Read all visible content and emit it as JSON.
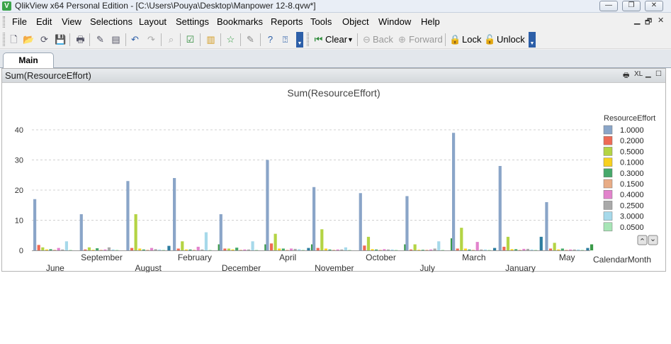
{
  "window": {
    "title": "QlikView x64 Personal Edition - [C:\\Users\\Pouya\\Desktop\\Manpower 12-8.qvw*]",
    "app_icon_letter": "V",
    "minimize": "—",
    "restore": "❐",
    "close": "✕"
  },
  "menu": {
    "items": [
      "File",
      "Edit",
      "View",
      "Selections",
      "Layout",
      "Settings",
      "Bookmarks",
      "Reports",
      "Tools",
      "Object",
      "Window",
      "Help"
    ],
    "mdi_minimize": "▁",
    "mdi_restore": "🗗",
    "mdi_close": "✕"
  },
  "toolbar": {
    "icons": [
      "new-icon",
      "open-icon",
      "reload-icon",
      "save-icon",
      "print-icon",
      "edit-script-icon",
      "reload-script-icon",
      "undo-icon",
      "redo-icon",
      "search-icon",
      "select-fields-icon",
      "new-chart-icon",
      "bookmark-star-icon",
      "edit-icon",
      "help-icon",
      "context-help-icon"
    ],
    "clear_label": "Clear",
    "back_label": "Back",
    "forward_label": "Forward",
    "lock_label": "Lock",
    "unlock_label": "Unlock"
  },
  "tabs": [
    {
      "label": "Main"
    }
  ],
  "chart_caption": {
    "title": "Sum(ResourceEffort)",
    "print_icon": "🖶",
    "xl_label": "XL",
    "minimize": "▁",
    "maximize": "☐"
  },
  "colors": {
    "1.0000": "#8aa5c8",
    "0.2000": "#ee6a55",
    "0.5000": "#b4d444",
    "0.1000": "#f7d11f",
    "0.3000": "#46a86a",
    "0.1500": "#e8ac86",
    "0.4000": "#e283cc",
    "0.2500": "#a9a9a9",
    "3.0000": "#a6d9ea",
    "0.0500": "#a7e5b6",
    "misc_dark_green": "#3a9a48",
    "misc_teal": "#2e7da0",
    "misc_dark": "#555555"
  },
  "chart_data": {
    "type": "bar",
    "title": "Sum(ResourceEffort)",
    "xlabel": "CalendarMonth",
    "legend_title": "ResourceEffort",
    "legend_position": "right",
    "ylim": [
      0,
      40
    ],
    "yticks": [
      0,
      10,
      20,
      30,
      40
    ],
    "grid": true,
    "categories": [
      "June",
      "September",
      "August",
      "February",
      "December",
      "April",
      "November",
      "October",
      "July",
      "March",
      "January",
      "May"
    ],
    "series": [
      {
        "name": "1.0000",
        "values": [
          17,
          12,
          23,
          24,
          12,
          30,
          21,
          19,
          18,
          39,
          28,
          16
        ]
      },
      {
        "name": "0.2000",
        "values": [
          1.8,
          0.3,
          0.8,
          0.6,
          0.6,
          2.3,
          0.8,
          1.6,
          0.3,
          0.6,
          1.2,
          0.6
        ]
      },
      {
        "name": "0.5000",
        "values": [
          1.0,
          1.0,
          12,
          3.0,
          0.6,
          5.5,
          7.0,
          4.5,
          2.0,
          7.5,
          4.5,
          2.5
        ]
      },
      {
        "name": "0.1000",
        "values": [
          0.3,
          0.2,
          0.6,
          0.3,
          0.3,
          0.6,
          0.6,
          0.4,
          0.2,
          0.6,
          0.4,
          0.3
        ]
      },
      {
        "name": "0.3000",
        "values": [
          0.4,
          0.7,
          0.3,
          0.3,
          0.9,
          0.6,
          0.3,
          0.3,
          0.2,
          0.3,
          0.4,
          0.6
        ]
      },
      {
        "name": "0.1500",
        "values": [
          0.2,
          0.2,
          0.2,
          0.2,
          0.2,
          0.2,
          0.2,
          0.2,
          0.2,
          0.2,
          0.2,
          0.2
        ]
      },
      {
        "name": "0.4000",
        "values": [
          0.8,
          0.3,
          0.8,
          1.2,
          0.3,
          0.6,
          0.3,
          0.4,
          0.3,
          2.8,
          0.5,
          0.3
        ]
      },
      {
        "name": "0.2500",
        "values": [
          0.3,
          1.0,
          0.4,
          0.3,
          0.3,
          0.5,
          0.3,
          0.3,
          0.6,
          0.3,
          0.5,
          0.3
        ]
      },
      {
        "name": "3.0000",
        "values": [
          3.0,
          0.3,
          0.3,
          6.0,
          3.0,
          0.4,
          1.0,
          0.3,
          3.0,
          0.3,
          0.3,
          0.3
        ]
      },
      {
        "name": "0.0500",
        "values": [
          0.2,
          0.2,
          0.2,
          0.2,
          0.2,
          0.2,
          0.2,
          0.2,
          0.2,
          0.2,
          0.2,
          0.2
        ]
      }
    ],
    "extra_bars": [
      {
        "color_key": "misc_teal",
        "values": [
          0,
          0,
          1.5,
          0,
          0,
          0.8,
          0,
          0,
          0,
          0.8,
          4.5,
          0.8
        ]
      },
      {
        "color_key": "misc_dark_green",
        "values": [
          0,
          0,
          0,
          2.0,
          2.0,
          2.0,
          0,
          2.0,
          4.0,
          0,
          0,
          2.0
        ]
      }
    ]
  }
}
